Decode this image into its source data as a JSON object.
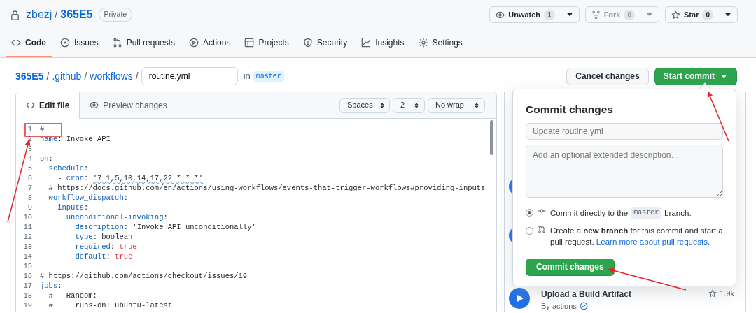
{
  "repo": {
    "owner": "zbezj",
    "separator": "/",
    "name": "365E5",
    "visibility": "Private"
  },
  "repo_actions": [
    {
      "kind": "watch",
      "label": "Unwatch",
      "count": "1",
      "disabled": false
    },
    {
      "kind": "fork",
      "label": "Fork",
      "count": "0",
      "disabled": true
    },
    {
      "kind": "star",
      "label": "Star",
      "count": "0",
      "disabled": false
    }
  ],
  "tabs": [
    {
      "label": "Code",
      "selected": true
    },
    {
      "label": "Issues",
      "selected": false
    },
    {
      "label": "Pull requests",
      "selected": false
    },
    {
      "label": "Actions",
      "selected": false
    },
    {
      "label": "Projects",
      "selected": false
    },
    {
      "label": "Security",
      "selected": false
    },
    {
      "label": "Insights",
      "selected": false
    },
    {
      "label": "Settings",
      "selected": false
    }
  ],
  "breadcrumb": [
    {
      "label": "365E5",
      "separator": "/"
    },
    {
      "label": ".github",
      "separator": "/"
    },
    {
      "label": "workflows",
      "separator": "/"
    }
  ],
  "filename": "routine.yml",
  "branch_prefix": "in",
  "branch": "master",
  "header_buttons": [
    {
      "kind": "secondary",
      "label": "Cancel changes"
    },
    {
      "kind": "primary",
      "label": "Start commit"
    }
  ],
  "editor": {
    "tabs": [
      {
        "label": "Edit file",
        "selected": true
      },
      {
        "label": "Preview changes",
        "selected": false
      }
    ],
    "selects": [
      "Spaces",
      "2",
      "No wrap"
    ],
    "lines": [
      {
        "number": "1",
        "tokens": [
          {
            "kind": "plain",
            "text": "#"
          }
        ]
      },
      {
        "number": "2",
        "tokens": [
          {
            "kind": "key",
            "text": "name"
          },
          {
            "kind": "plain",
            "text": ": Invoke API"
          }
        ]
      },
      {
        "number": "3"
      },
      {
        "number": "4",
        "tokens": [
          {
            "kind": "key",
            "text": "on"
          },
          {
            "kind": "plain",
            "text": ":"
          }
        ]
      },
      {
        "number": "5",
        "tokens": [
          {
            "kind": "key",
            "text": "  schedule"
          },
          {
            "kind": "plain",
            "text": ":"
          }
        ]
      },
      {
        "number": "6",
        "tokens": [
          {
            "kind": "plain",
            "text": "    - "
          },
          {
            "kind": "key",
            "text": "cron"
          },
          {
            "kind": "plain",
            "text": ": "
          },
          {
            "kind": "flagged",
            "text": "'7 1,5,10,14,17,22 * * *'"
          }
        ]
      },
      {
        "number": "7",
        "tokens": [
          {
            "kind": "plain",
            "text": "  # https://docs.github.com/en/actions/using-workflows/events-that-trigger-workflows#providing-inputs"
          }
        ]
      },
      {
        "number": "8",
        "tokens": [
          {
            "kind": "key",
            "text": "  workflow_dispatch"
          },
          {
            "kind": "plain",
            "text": ":"
          }
        ]
      },
      {
        "number": "9",
        "tokens": [
          {
            "kind": "key",
            "text": "    inputs"
          },
          {
            "kind": "plain",
            "text": ":"
          }
        ]
      },
      {
        "number": "10",
        "tokens": [
          {
            "kind": "key",
            "text": "      unconditional-invoking"
          },
          {
            "kind": "plain",
            "text": ":"
          }
        ]
      },
      {
        "number": "11",
        "tokens": [
          {
            "kind": "key",
            "text": "        description"
          },
          {
            "kind": "plain",
            "text": ": 'Invoke API unconditionally'"
          }
        ]
      },
      {
        "number": "12",
        "tokens": [
          {
            "kind": "key",
            "text": "        type"
          },
          {
            "kind": "plain",
            "text": ": boolean"
          }
        ]
      },
      {
        "number": "13",
        "tokens": [
          {
            "kind": "key",
            "text": "        required"
          },
          {
            "kind": "plain",
            "text": ": "
          },
          {
            "kind": "bool",
            "text": "true"
          }
        ]
      },
      {
        "number": "14",
        "tokens": [
          {
            "kind": "key",
            "text": "        default"
          },
          {
            "kind": "plain",
            "text": ": "
          },
          {
            "kind": "bool",
            "text": "true"
          }
        ]
      },
      {
        "number": "15"
      },
      {
        "number": "16",
        "tokens": [
          {
            "kind": "plain",
            "text": "# https://github.com/actions/checkout/issues/19"
          }
        ]
      },
      {
        "number": "17",
        "tokens": [
          {
            "kind": "key",
            "text": "jobs"
          },
          {
            "kind": "plain",
            "text": ":"
          }
        ]
      },
      {
        "number": "18",
        "tokens": [
          {
            "kind": "plain",
            "text": "  #   Random:"
          }
        ]
      },
      {
        "number": "19",
        "tokens": [
          {
            "kind": "plain",
            "text": "  #     runs-on: ubuntu-latest"
          }
        ]
      }
    ]
  },
  "marketplace": {
    "items": [
      {
        "title": "Upload a Build Artifact",
        "author": "By actions",
        "star_count": "1.9k",
        "verified": true
      }
    ]
  },
  "commit_dialog": {
    "title": "Commit changes",
    "summary_placeholder": "Update routine.yml",
    "description_placeholder": "Add an optional extended description…",
    "options": [
      {
        "kind": "direct",
        "selected": true,
        "before": "Commit directly to the",
        "branch": "master",
        "after": "branch."
      },
      {
        "kind": "new_branch",
        "selected": false,
        "text": "Create a **new branch** for this commit and start a pull request.",
        "link": "Learn more about pull requests."
      }
    ],
    "button": "Commit changes"
  }
}
